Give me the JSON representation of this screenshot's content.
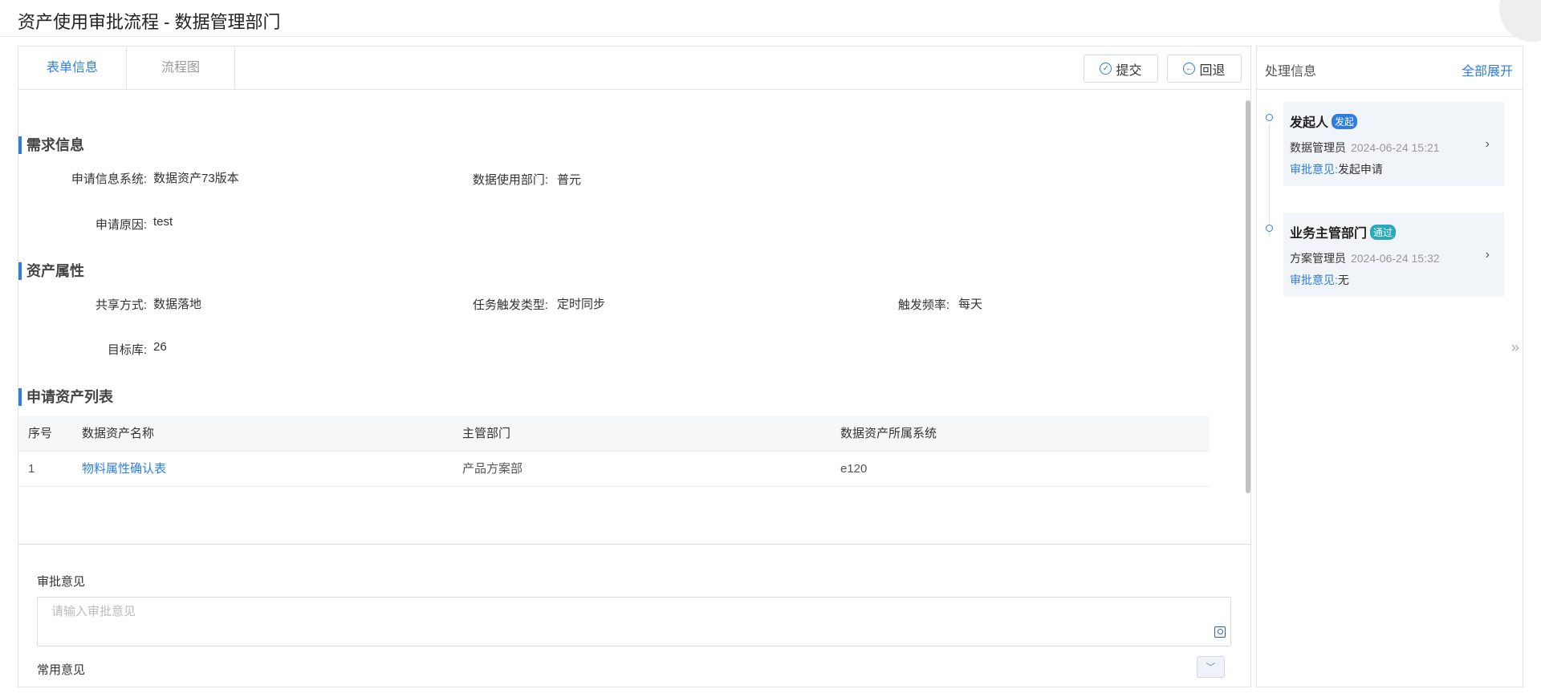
{
  "window": {
    "title": "资产使用审批流程 - 数据管理部门",
    "close_glyph": "✕"
  },
  "tabs": [
    {
      "label": "表单信息",
      "active": true
    },
    {
      "label": "流程图",
      "active": false
    }
  ],
  "toolbar": {
    "submit_label": "提交",
    "back_label": "回退"
  },
  "sections": {
    "requirement": {
      "title": "需求信息",
      "system_label": "申请信息系统:",
      "system_value": "数据资产73版本",
      "dept_label": "数据使用部门:",
      "dept_value": "普元",
      "reason_label": "申请原因:",
      "reason_value": "test"
    },
    "attributes": {
      "title": "资产属性",
      "share_label": "共享方式:",
      "share_value": "数据落地",
      "trigger_label": "任务触发类型:",
      "trigger_value": "定时同步",
      "freq_label": "触发频率:",
      "freq_value": "每天",
      "target_label": "目标库:",
      "target_value": "26"
    },
    "assets": {
      "title": "申请资产列表",
      "columns": [
        "序号",
        "数据资产名称",
        "主管部门",
        "数据资产所属系统"
      ],
      "rows": [
        {
          "index": "1",
          "name": "物料属性确认表",
          "dept": "产品方案部",
          "system": "e120"
        }
      ]
    }
  },
  "opinion": {
    "label": "审批意见",
    "placeholder": "请输入审批意见",
    "common_label": "常用意见"
  },
  "side": {
    "title": "处理信息",
    "expand_all": "全部展开",
    "opinion_prefix": "审批意见:",
    "records": [
      {
        "name": "发起人",
        "badge": "发起",
        "role": "数据管理员",
        "time": "2024-06-24 15:21",
        "opinion": "发起申请"
      },
      {
        "name": "业务主管部门",
        "badge": "通过",
        "role": "方案管理员",
        "time": "2024-06-24 15:32",
        "opinion": "无"
      }
    ]
  },
  "colors": {
    "accent": "#2f7de1",
    "badge_pass": "#2aa9b8",
    "card_bg": "#f1f4f9"
  },
  "icons": {
    "submit": "check-circle-icon",
    "back": "back-arrow-circle-icon",
    "card_arrow": "chevron-right-icon",
    "collapse": "double-chevron-right-icon",
    "dropdown": "chevron-down-icon"
  }
}
